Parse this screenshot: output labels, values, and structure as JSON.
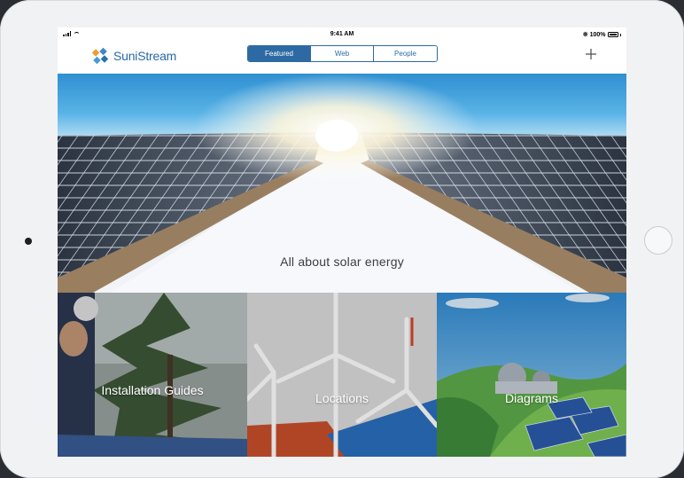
{
  "status_bar": {
    "time": "9:41 AM",
    "battery": "100%"
  },
  "nav": {
    "app_name": "SuniStream",
    "tabs": [
      {
        "label": "Featured",
        "active": true
      },
      {
        "label": "Web",
        "active": false
      },
      {
        "label": "People",
        "active": false
      }
    ],
    "add_icon": "plus-icon"
  },
  "hero": {
    "title": "All about solar energy"
  },
  "tiles": [
    {
      "label": "Installation Guides"
    },
    {
      "label": "Locations"
    },
    {
      "label": "Diagrams"
    }
  ],
  "colors": {
    "brand": "#2869a8",
    "segment_active": "#2d6aa3"
  }
}
